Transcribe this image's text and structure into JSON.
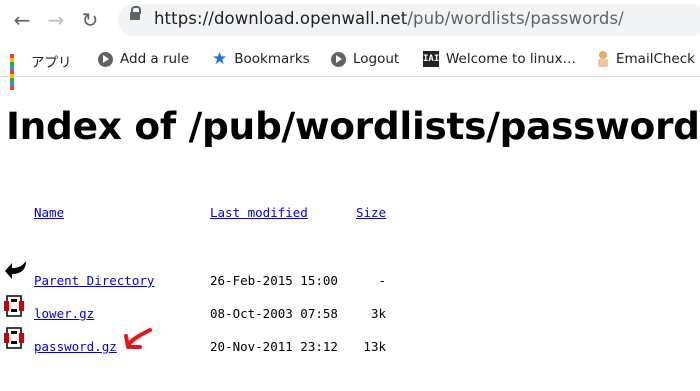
{
  "browser": {
    "url_host": "https://download.openwall.net",
    "url_path": "/pub/wordlists/passwords/"
  },
  "bookmarks": [
    {
      "icon": "apps-icon",
      "label": "アプリ"
    },
    {
      "icon": "web-store-icon",
      "label": "Add a rule"
    },
    {
      "icon": "star-icon",
      "label": "Bookmarks"
    },
    {
      "icon": "web-store-icon",
      "label": "Logout"
    },
    {
      "icon": "tux-icon",
      "label": "Welcome to linux…"
    },
    {
      "icon": "emailcheck-icon",
      "label": "EmailCheck"
    }
  ],
  "page": {
    "title": "Index of /pub/wordlists/passwords",
    "headers": {
      "name": "Name",
      "last_modified": "Last modified",
      "size": "Size"
    },
    "rows": [
      {
        "icon": "back-arrow-icon",
        "name": "Parent Directory",
        "date": "26-Feb-2015 15:00",
        "size": "-"
      },
      {
        "icon": "compressed-file-icon",
        "name": "lower.gz",
        "date": "08-Oct-2003 07:58",
        "size": "3k"
      },
      {
        "icon": "compressed-file-icon",
        "name": "password.gz",
        "date": "20-Nov-2011 23:12",
        "size": "13k"
      }
    ]
  },
  "colors": {
    "link": "#0000ee",
    "annotation_arrow": "#e8141c"
  }
}
